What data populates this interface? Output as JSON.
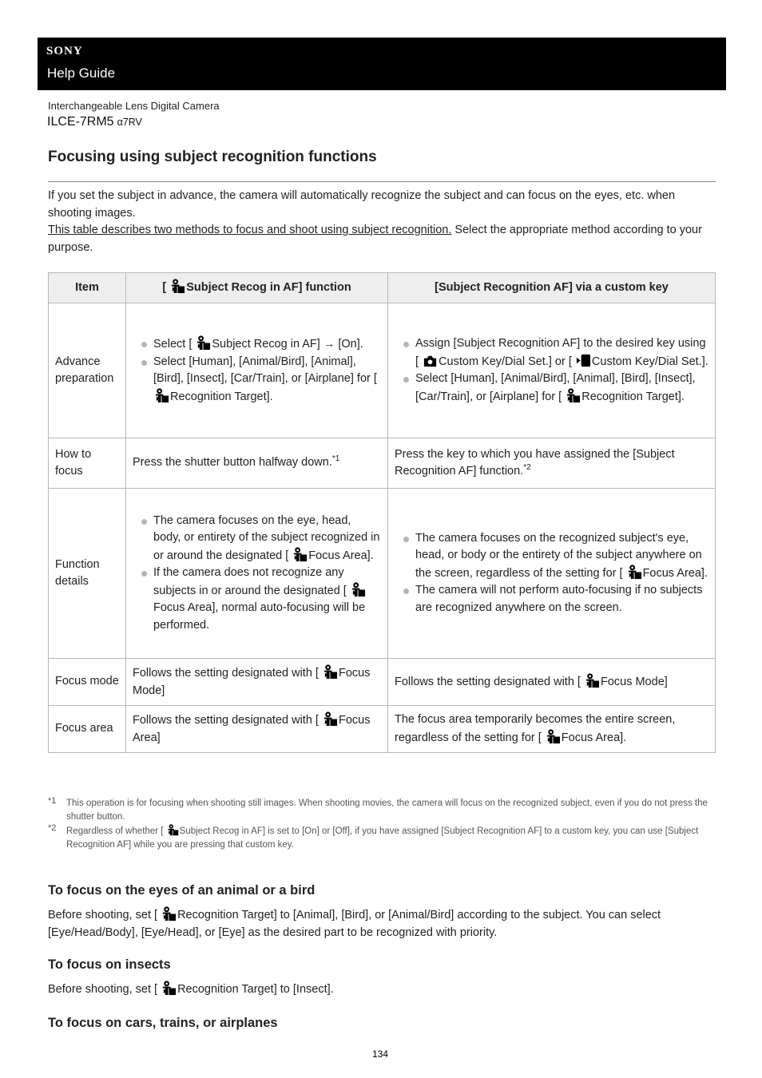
{
  "header": {
    "brand": "SONY",
    "guide_title": "Help Guide",
    "product_type": "Interchangeable Lens Digital Camera",
    "model": "ILCE-7RM5",
    "model_alias": "α7RV"
  },
  "page": {
    "title": "Focusing using subject recognition functions",
    "intro_1": "If you set the subject in advance, the camera will automatically recognize the subject and can focus on the eyes, etc. when shooting images.",
    "intro_link": "This table describes two methods to focus and shoot using subject recognition.",
    "intro_2": " Select the appropriate method according to your purpose.",
    "page_number": "134"
  },
  "icons": {
    "subject_recog": "subject-recognition-icon",
    "camera": "still-camera-icon",
    "movie": "movie-camera-icon"
  },
  "table": {
    "headers": {
      "item": "Item",
      "col2_pre": "[ ",
      "col2_post": "Subject Recog in AF] function",
      "col3": "[Subject Recognition AF] via a custom key"
    },
    "rows": {
      "advance": {
        "label": "Advance preparation",
        "c2_b1_pre": "Select [ ",
        "c2_b1_post": "Subject Recog in AF] → [On].",
        "c2_b2_pre": "Select [Human], [Animal/Bird], [Animal], [Bird], [Insect], [Car/Train], or [Airplane] for [ ",
        "c2_b2_post": "Recognition Target].",
        "c3_b1_pre": "Assign [Subject Recognition AF] to the desired key using [ ",
        "c3_b1_mid": "Custom Key/Dial Set.] or [ ",
        "c3_b1_post": "Custom Key/Dial Set.].",
        "c3_b2_pre": "Select [Human], [Animal/Bird], [Animal], [Bird], [Insect], [Car/Train], or [Airplane] for [ ",
        "c3_b2_post": "Recognition Target]."
      },
      "how": {
        "label": "How to focus",
        "c2": "Press the shutter button halfway down.",
        "c2_note": "*1",
        "c3": "Press the key to which you have assigned the [Subject Recognition AF] function.",
        "c3_note": "*2"
      },
      "details": {
        "label": "Function details",
        "c2_b1_pre": "The camera focuses on the eye, head, body, or entirety of the subject recognized in or around the designated [ ",
        "c2_b1_post": "Focus Area].",
        "c2_b2_pre": "If the camera does not recognize any subjects in or around the designated [ ",
        "c2_b2_post": "Focus Area], normal auto-focusing will be performed.",
        "c3_b1_pre": "The camera focuses on the recognized subject's eye, head, or body or the entirety of the subject anywhere on the screen, regardless of the setting for [ ",
        "c3_b1_post": "Focus Area].",
        "c3_b2": "The camera will not perform auto-focusing if no subjects are recognized anywhere on the screen."
      },
      "mode": {
        "label": "Focus mode",
        "c2_pre": "Follows the setting designated with [ ",
        "c2_post": "Focus Mode]",
        "c3_pre": "Follows the setting designated with [ ",
        "c3_post": "Focus Mode]"
      },
      "area": {
        "label": "Focus area",
        "c2_pre": "Follows the setting designated with [ ",
        "c2_post": "Focus Area]",
        "c3_pre": "The focus area temporarily becomes the entire screen, regardless of the setting for [ ",
        "c3_post": "Focus Area]."
      }
    }
  },
  "footnotes": [
    {
      "mark": "*1",
      "text": "This operation is for focusing when shooting still images. When shooting movies, the camera will focus on the recognized subject, even if you do not press the shutter button."
    },
    {
      "mark": "*2",
      "text_pre": "Regardless of whether [ ",
      "text_post": "Subject Recog in AF] is set to [On] or [Off], if you have assigned [Subject Recognition AF] to a custom key, you can use [Subject Recognition AF] while you are pressing that custom key."
    }
  ],
  "sections": [
    {
      "heading": "To focus on the eyes of an animal or a bird",
      "text_pre": "Before shooting, set [ ",
      "text_post": "Recognition Target] to [Animal], [Bird], or [Animal/Bird] according to the subject. You can select [Eye/Head/Body], [Eye/Head], or [Eye] as the desired part to be recognized with priority."
    },
    {
      "heading": "To focus on insects",
      "text_pre": "Before shooting, set [ ",
      "text_post": "Recognition Target] to [Insect]."
    },
    {
      "heading": "To focus on cars, trains, or airplanes"
    }
  ]
}
